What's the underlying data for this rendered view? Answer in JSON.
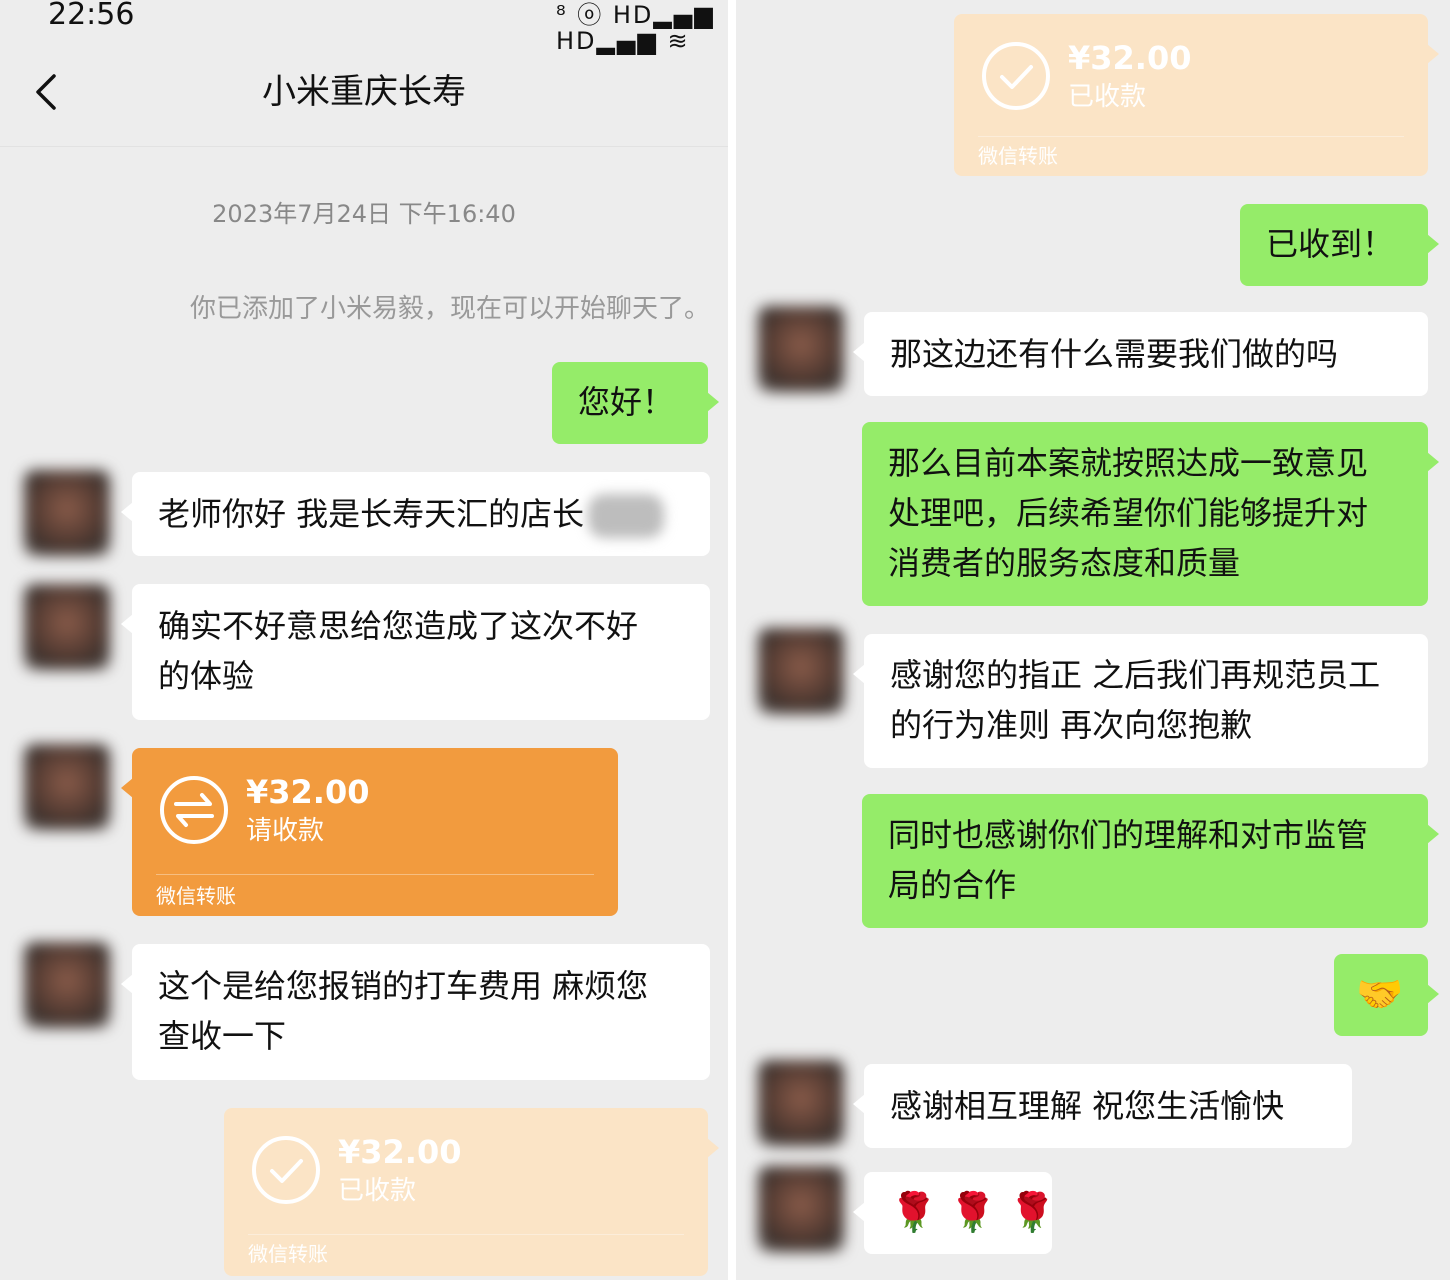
{
  "status_bar": {
    "time": "22:56",
    "icons_text": "⁸ ⓞ HD▂▄▆ HD▂▄▆ ≋"
  },
  "header": {
    "title": "小米重庆长寿"
  },
  "chat": {
    "timestamp": "2023年7月24日 下午16:40",
    "system_notice": "你已添加了小米易毅，现在可以开始聊天了。",
    "left_panel": {
      "msg_out_hello": "您好！",
      "msg_in_1": "老师你好 我是长寿天汇的店长",
      "msg_in_2_line1": "确实不好意思给您造成了这次不好",
      "msg_in_2_line2": "的体验",
      "transfer_pending": {
        "amount": "¥32.00",
        "status": "请收款",
        "footer": "微信转账"
      },
      "msg_in_3_line1": "这个是给您报销的打车费用 麻烦您",
      "msg_in_3_line2": "查收一下",
      "transfer_received": {
        "amount": "¥32.00",
        "status": "已收款",
        "footer": "微信转账"
      }
    },
    "right_panel": {
      "transfer_received": {
        "amount": "¥32.00",
        "status": "已收款",
        "footer": "微信转账"
      },
      "msg_out_received": "已收到！",
      "msg_in_1": "那这边还有什么需要我们做的吗",
      "msg_out_2_line1": "那么目前本案就按照达成一致意见",
      "msg_out_2_line2": "处理吧，后续希望你们能够提升对",
      "msg_out_2_line3": "消费者的服务态度和质量",
      "msg_in_2_line1": "感谢您的指正 之后我们再规范员工",
      "msg_in_2_line2": "的行为准则 再次向您抱歉",
      "msg_out_3_line1": "同时也感谢你们的理解和对市监管",
      "msg_out_3_line2": "局的合作",
      "msg_out_handshake": "🤝",
      "msg_in_3": "感谢相互理解 祝您生活愉快",
      "msg_in_roses": "🌹 🌹 🌹"
    }
  },
  "colors": {
    "bubble_out": "#95ec69",
    "bubble_in": "#ffffff",
    "transfer_pending": "#f29b3e",
    "transfer_done": "#fbe4c6",
    "background": "#ededed"
  }
}
